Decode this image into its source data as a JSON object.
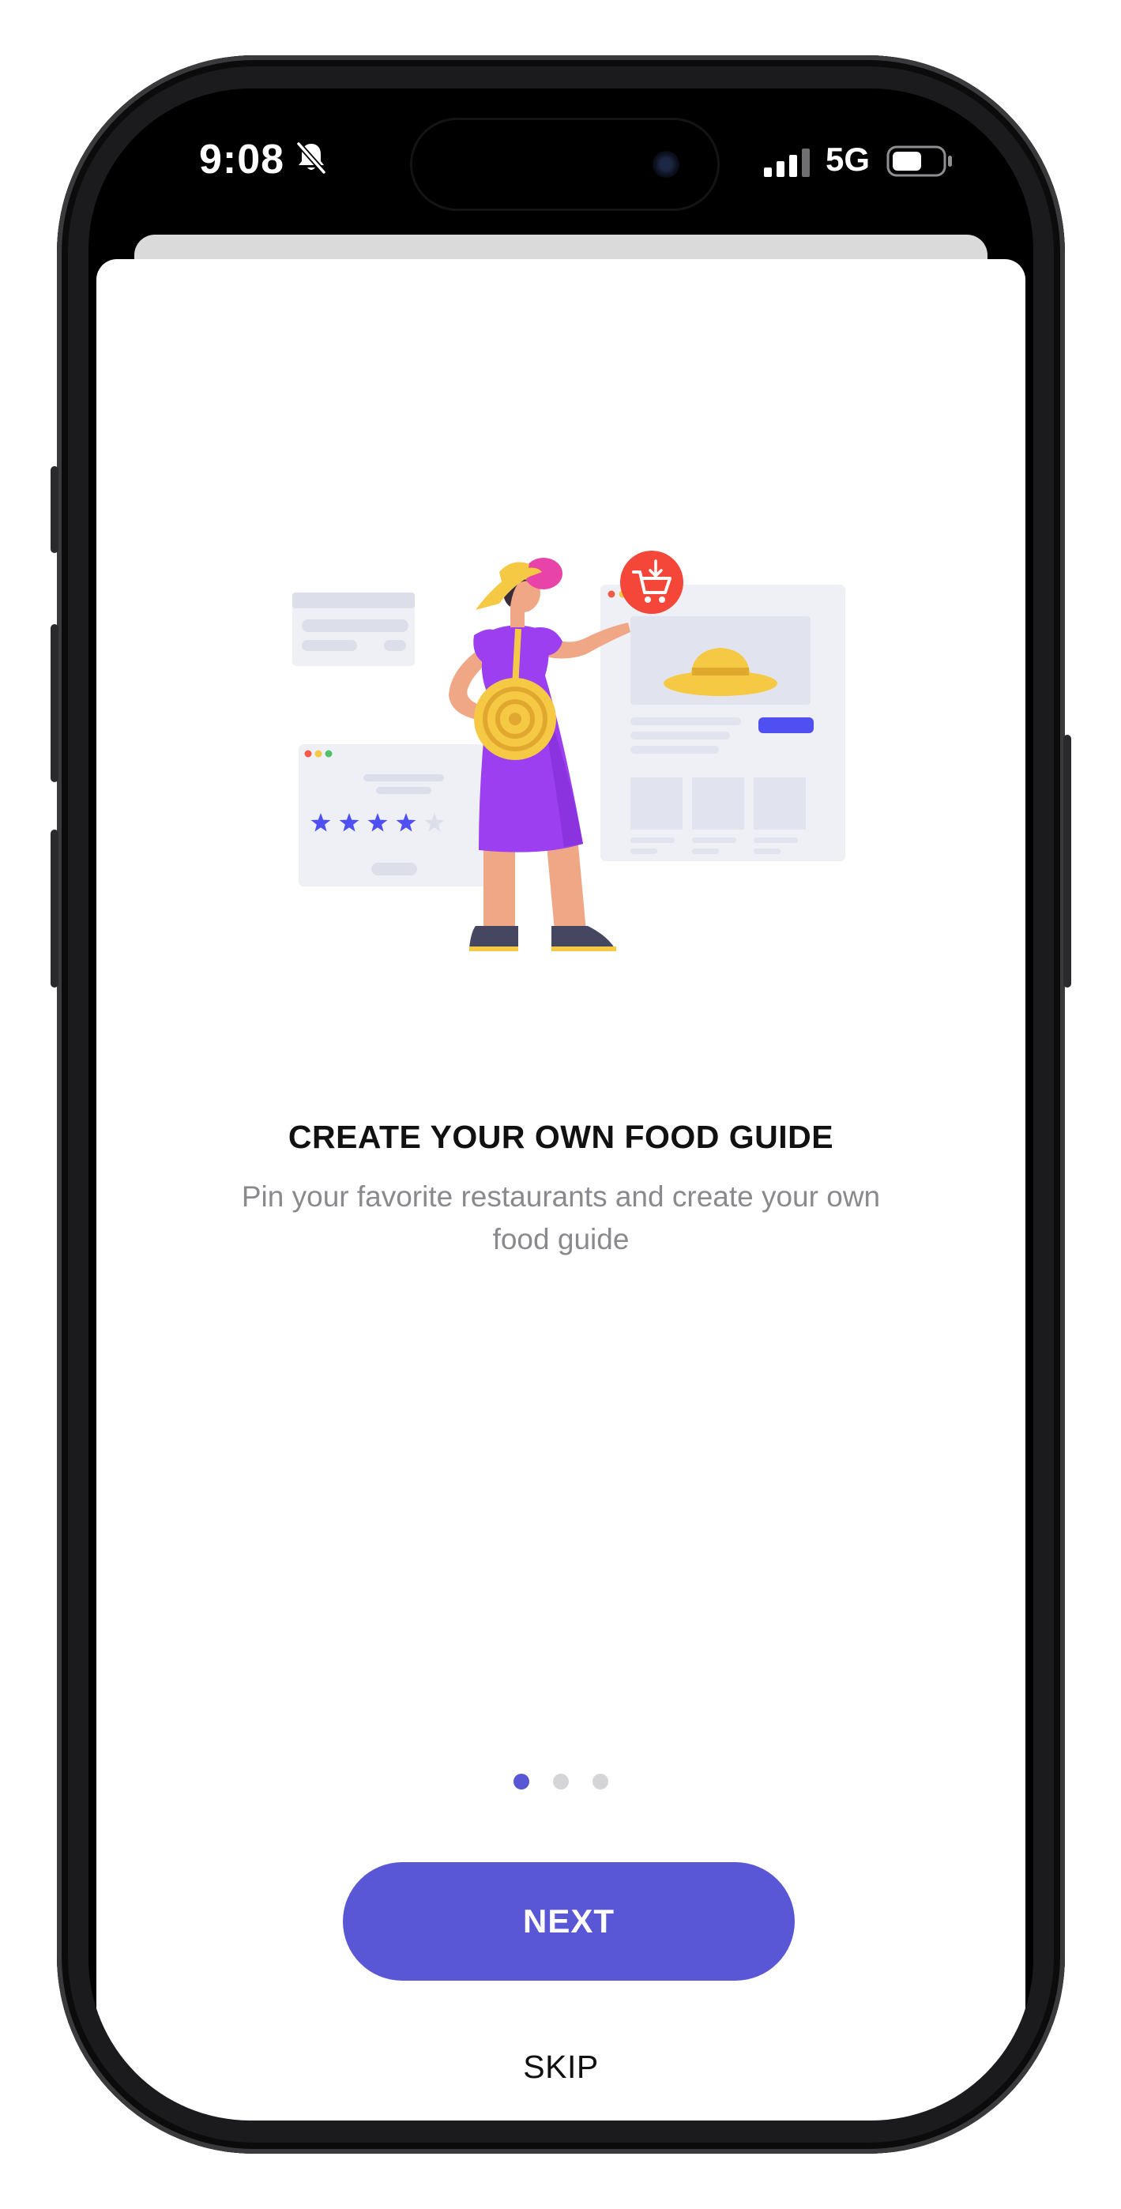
{
  "status_bar": {
    "time": "9:08",
    "network": "5G",
    "icons": [
      "bell-slash-icon",
      "signal-bars-icon",
      "battery-icon"
    ]
  },
  "onboarding": {
    "title": "CREATE YOUR OWN FOOD GUIDE",
    "subtitle": "Pin your favorite restaurants and create your own food guide",
    "illustration": "woman-shopping-illustration",
    "rating_stars": {
      "filled": 4,
      "total": 5
    },
    "pager": {
      "current": 1,
      "total": 3
    }
  },
  "actions": {
    "next_label": "NEXT",
    "skip_label": "SKIP"
  },
  "colors": {
    "accent": "#5A57D6",
    "title_text": "#111111",
    "subtitle_text": "#8A8A8E",
    "cart_badge": "#F4473A",
    "dress": "#9B3FF0",
    "hat": "#F6C945"
  }
}
